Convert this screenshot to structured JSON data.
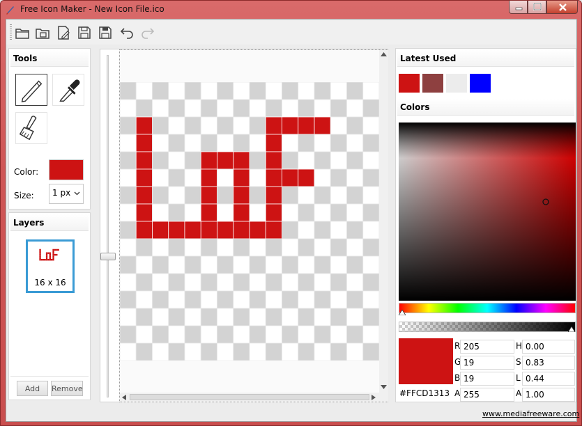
{
  "window": {
    "title": "Free Icon Maker - New Icon File.ico"
  },
  "toolbar": {
    "buttons": [
      "open-folder-icon",
      "open-image-icon",
      "new-file-icon",
      "save-icon",
      "save-as-icon",
      "undo-icon",
      "redo-icon"
    ]
  },
  "tools_panel": {
    "title": "Tools",
    "tools": [
      "pencil-icon",
      "eyedropper-icon",
      "fill-brush-icon"
    ],
    "color_label": "Color:",
    "color_value": "#CD1313",
    "size_label": "Size:",
    "size_value": "1 px"
  },
  "layers_panel": {
    "title": "Layers",
    "layer_label": "16 x 16",
    "add_label": "Add",
    "remove_label": "Remove"
  },
  "canvas": {
    "grid_size": 16,
    "pixels": [
      "................",
      "................",
      ".#.......####...",
      ".#.......#......",
      ".#...###.#......",
      ".#...#.#.###....",
      ".#...#.#.#......",
      ".#...#.#.#......",
      ".#########......",
      "................",
      "................",
      "................",
      "................",
      "................",
      "................",
      "................"
    ],
    "ink_color": "#CD1313"
  },
  "latest_panel": {
    "title": "Latest Used",
    "colors": [
      "#CD1313",
      "#8E4040",
      "#ECECEC",
      "#0000FF"
    ]
  },
  "colors_panel": {
    "title": "Colors",
    "hex": "#FFCD1313",
    "fields": {
      "R": "205",
      "G": "19",
      "B": "19",
      "A": "255",
      "H": "0.00",
      "S": "0.83",
      "L": "0.44",
      "A2": "1.00"
    },
    "labels": {
      "R": "R",
      "G": "G",
      "B": "B",
      "A": "A",
      "H": "H",
      "S": "S",
      "L": "L",
      "A2": "A"
    }
  },
  "footer": {
    "link": "www.mediafreeware.com"
  }
}
